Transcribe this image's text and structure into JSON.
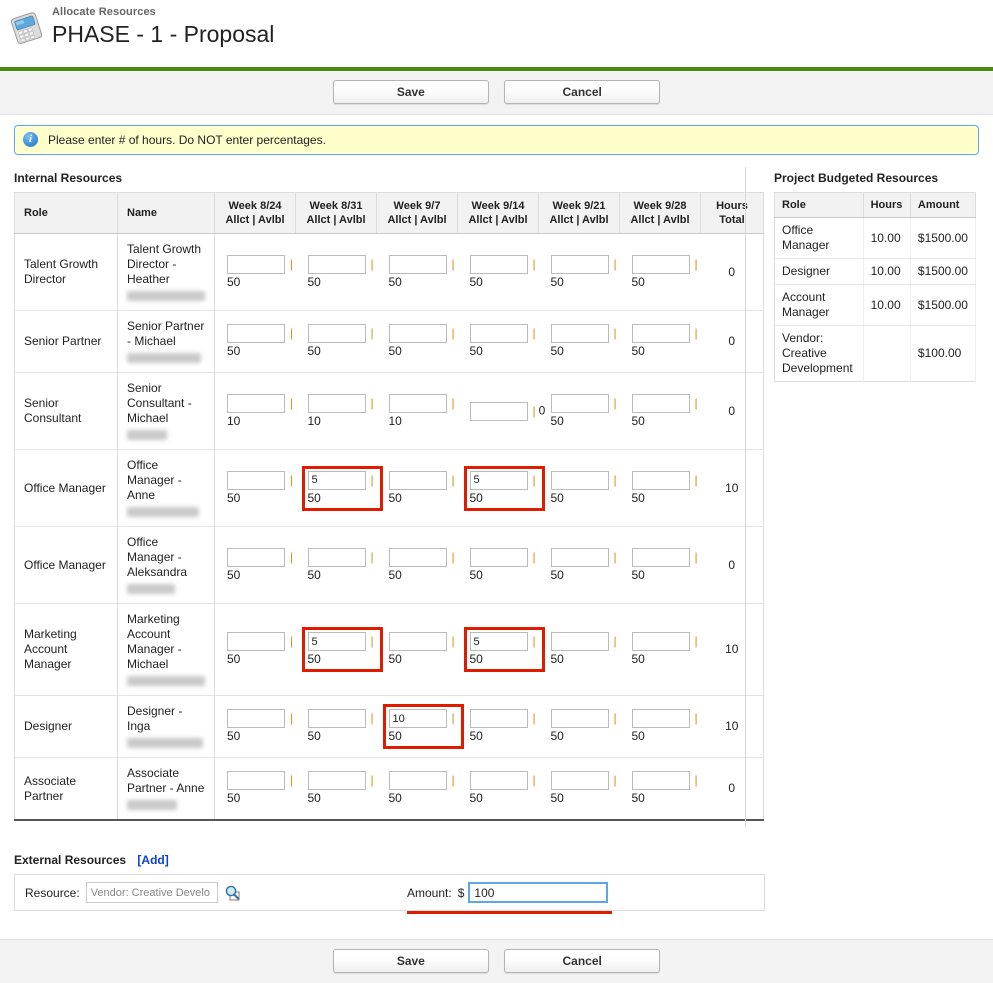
{
  "header": {
    "breadcrumb": "Allocate Resources",
    "title": "PHASE - 1 - Proposal",
    "icon": "calculator-device-icon"
  },
  "toolbar": {
    "save_label": "Save",
    "cancel_label": "Cancel"
  },
  "message": {
    "icon": "info-icon",
    "text": "Please enter # of hours. Do NOT enter percentages."
  },
  "internal": {
    "section_title": "Internal Resources",
    "columns": {
      "role": "Role",
      "name": "Name",
      "weeks": [
        {
          "week": "Week 8/24",
          "sub": "Allct | Avlbl"
        },
        {
          "week": "Week 8/31",
          "sub": "Allct | Avlbl"
        },
        {
          "week": "Week 9/7",
          "sub": "Allct | Avlbl"
        },
        {
          "week": "Week 9/14",
          "sub": "Allct | Avlbl"
        },
        {
          "week": "Week 9/21",
          "sub": "Allct | Avlbl"
        },
        {
          "week": "Week 9/28",
          "sub": "Allct | Avlbl"
        }
      ],
      "total": "Hours Total"
    },
    "separator": "|",
    "rows": [
      {
        "role": "Talent Growth Director",
        "name": "Talent Growth Director - Heather",
        "name_redacted": true,
        "redacted_width": 78,
        "cells": [
          {
            "allocated": "",
            "available": "50",
            "marked": false,
            "inline": false
          },
          {
            "allocated": "",
            "available": "50",
            "marked": false,
            "inline": false
          },
          {
            "allocated": "",
            "available": "50",
            "marked": false,
            "inline": false
          },
          {
            "allocated": "",
            "available": "50",
            "marked": false,
            "inline": false
          },
          {
            "allocated": "",
            "available": "50",
            "marked": false,
            "inline": false
          },
          {
            "allocated": "",
            "available": "50",
            "marked": false,
            "inline": false
          }
        ],
        "total": "0"
      },
      {
        "role": "Senior Partner",
        "name": "Senior Partner - Michael",
        "name_redacted": true,
        "redacted_width": 74,
        "cells": [
          {
            "allocated": "",
            "available": "50",
            "marked": false,
            "inline": false
          },
          {
            "allocated": "",
            "available": "50",
            "marked": false,
            "inline": false
          },
          {
            "allocated": "",
            "available": "50",
            "marked": false,
            "inline": false
          },
          {
            "allocated": "",
            "available": "50",
            "marked": false,
            "inline": false
          },
          {
            "allocated": "",
            "available": "50",
            "marked": false,
            "inline": false
          },
          {
            "allocated": "",
            "available": "50",
            "marked": false,
            "inline": false
          }
        ],
        "total": "0"
      },
      {
        "role": "Senior Consultant",
        "name": "Senior Consultant - Michael",
        "name_redacted": true,
        "redacted_width": 40,
        "cells": [
          {
            "allocated": "",
            "available": "10",
            "marked": false,
            "inline": false
          },
          {
            "allocated": "",
            "available": "10",
            "marked": false,
            "inline": false
          },
          {
            "allocated": "",
            "available": "10",
            "marked": false,
            "inline": false
          },
          {
            "allocated": "",
            "available": "0",
            "marked": false,
            "inline": true
          },
          {
            "allocated": "",
            "available": "50",
            "marked": false,
            "inline": false
          },
          {
            "allocated": "",
            "available": "50",
            "marked": false,
            "inline": false
          }
        ],
        "total": "0"
      },
      {
        "role": "Office Manager",
        "name": "Office Manager - Anne",
        "name_redacted": true,
        "redacted_width": 72,
        "cells": [
          {
            "allocated": "",
            "available": "50",
            "marked": false,
            "inline": false
          },
          {
            "allocated": "5",
            "available": "50",
            "marked": true,
            "inline": false
          },
          {
            "allocated": "",
            "available": "50",
            "marked": false,
            "inline": false
          },
          {
            "allocated": "5",
            "available": "50",
            "marked": true,
            "inline": false
          },
          {
            "allocated": "",
            "available": "50",
            "marked": false,
            "inline": false
          },
          {
            "allocated": "",
            "available": "50",
            "marked": false,
            "inline": false
          }
        ],
        "total": "10"
      },
      {
        "role": "Office Manager",
        "name": "Office Manager - Aleksandra",
        "name_redacted": true,
        "redacted_width": 48,
        "cells": [
          {
            "allocated": "",
            "available": "50",
            "marked": false,
            "inline": false
          },
          {
            "allocated": "",
            "available": "50",
            "marked": false,
            "inline": false
          },
          {
            "allocated": "",
            "available": "50",
            "marked": false,
            "inline": false
          },
          {
            "allocated": "",
            "available": "50",
            "marked": false,
            "inline": false
          },
          {
            "allocated": "",
            "available": "50",
            "marked": false,
            "inline": false
          },
          {
            "allocated": "",
            "available": "50",
            "marked": false,
            "inline": false
          }
        ],
        "total": "0"
      },
      {
        "role": "Marketing Account Manager",
        "name": "Marketing Account Manager - Michael",
        "name_redacted": true,
        "redacted_width": 78,
        "cells": [
          {
            "allocated": "",
            "available": "50",
            "marked": false,
            "inline": false
          },
          {
            "allocated": "5",
            "available": "50",
            "marked": true,
            "inline": false
          },
          {
            "allocated": "",
            "available": "50",
            "marked": false,
            "inline": false
          },
          {
            "allocated": "5",
            "available": "50",
            "marked": true,
            "inline": false
          },
          {
            "allocated": "",
            "available": "50",
            "marked": false,
            "inline": false
          },
          {
            "allocated": "",
            "available": "50",
            "marked": false,
            "inline": false
          }
        ],
        "total": "10"
      },
      {
        "role": "Designer",
        "name": "Designer - Inga",
        "name_redacted": true,
        "redacted_width": 76,
        "cells": [
          {
            "allocated": "",
            "available": "50",
            "marked": false,
            "inline": false
          },
          {
            "allocated": "",
            "available": "50",
            "marked": false,
            "inline": false
          },
          {
            "allocated": "10",
            "available": "50",
            "marked": true,
            "inline": false
          },
          {
            "allocated": "",
            "available": "50",
            "marked": false,
            "inline": false
          },
          {
            "allocated": "",
            "available": "50",
            "marked": false,
            "inline": false
          },
          {
            "allocated": "",
            "available": "50",
            "marked": false,
            "inline": false
          }
        ],
        "total": "10"
      },
      {
        "role": "Associate Partner",
        "name": "Associate Partner - Anne",
        "name_redacted": true,
        "redacted_width": 50,
        "cells": [
          {
            "allocated": "",
            "available": "50",
            "marked": false,
            "inline": false
          },
          {
            "allocated": "",
            "available": "50",
            "marked": false,
            "inline": false
          },
          {
            "allocated": "",
            "available": "50",
            "marked": false,
            "inline": false
          },
          {
            "allocated": "",
            "available": "50",
            "marked": false,
            "inline": false
          },
          {
            "allocated": "",
            "available": "50",
            "marked": false,
            "inline": false
          },
          {
            "allocated": "",
            "available": "50",
            "marked": false,
            "inline": false
          }
        ],
        "total": "0"
      }
    ]
  },
  "budget": {
    "section_title": "Project Budgeted Resources",
    "columns": {
      "role": "Role",
      "hours": "Hours",
      "amount": "Amount"
    },
    "rows": [
      {
        "role": "Office Manager",
        "hours": "10.00",
        "amount": "$1500.00"
      },
      {
        "role": "Designer",
        "hours": "10.00",
        "amount": "$1500.00"
      },
      {
        "role": "Account Manager",
        "hours": "10.00",
        "amount": "$1500.00"
      },
      {
        "role": "Vendor: Creative Development",
        "hours": "",
        "amount": "$100.00"
      }
    ]
  },
  "external": {
    "section_title": "External Resources",
    "add_label": "[Add]",
    "resource_label": "Resource:",
    "resource_value": "Vendor: Creative Develo",
    "lookup_icon": "magnifier-lookup-icon",
    "amount_label": "Amount:",
    "currency": "$",
    "amount_value": "100"
  },
  "colors": {
    "accent_green": "#4a8a0f",
    "highlight_red": "#e01b00",
    "focus_blue": "#5aa9e6",
    "link_blue": "#0b41cd",
    "message_bg": "#ffffcc"
  }
}
